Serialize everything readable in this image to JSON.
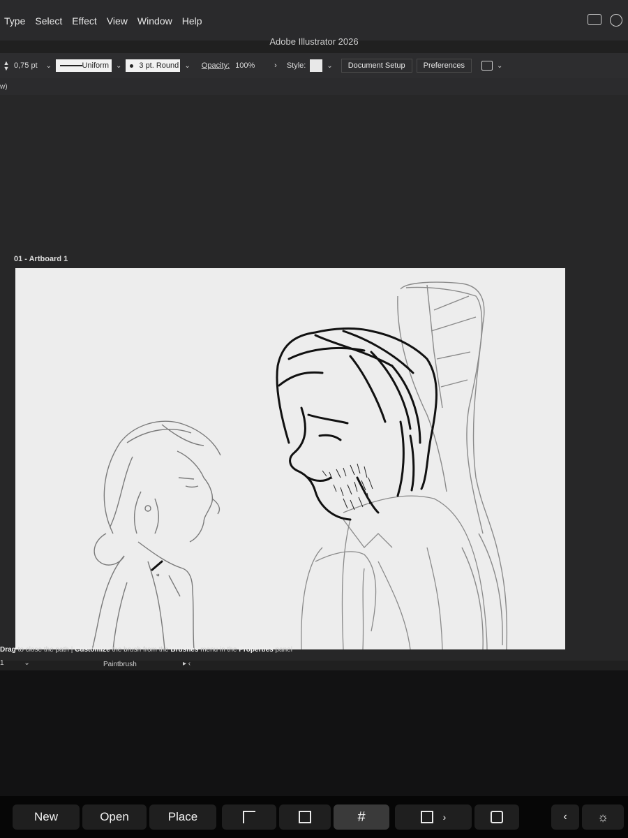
{
  "menubar": {
    "items": [
      "Type",
      "Select",
      "Effect",
      "View",
      "Window",
      "Help"
    ],
    "icons": [
      "display-icon",
      "creative-cloud-icon"
    ]
  },
  "app_title": "Adobe Illustrator 2026",
  "control_bar": {
    "stroke_weight": "0,75 pt",
    "variable_width_profile": "Uniform",
    "brush_definition": "3 pt. Round",
    "opacity_label": "Opacity:",
    "opacity_value": "100%",
    "style_label": "Style:",
    "document_setup_label": "Document Setup",
    "preferences_label": "Preferences"
  },
  "subbar_text": "w)",
  "artboard": {
    "label": "01 - Artboard 1"
  },
  "status": {
    "hint_prefix": "Drag",
    "hint_part1": " to close the path  |  ",
    "hint_customize": "Customize",
    "hint_part2": " the brush from the ",
    "hint_brushes": "Brushes",
    "hint_part3": " menu in the ",
    "hint_properties": "Properties",
    "hint_part4": " panel",
    "zoom": "1",
    "current_tool": "Paintbrush"
  },
  "touchbar": {
    "new_label": "New",
    "open_label": "Open",
    "place_label": "Place"
  },
  "colors": {
    "menubar_bg": "#2a2a2c",
    "canvas_bg": "#272728",
    "artboard_bg": "#ededed",
    "ink": "#111111",
    "sketch": "#8a8a8a"
  }
}
